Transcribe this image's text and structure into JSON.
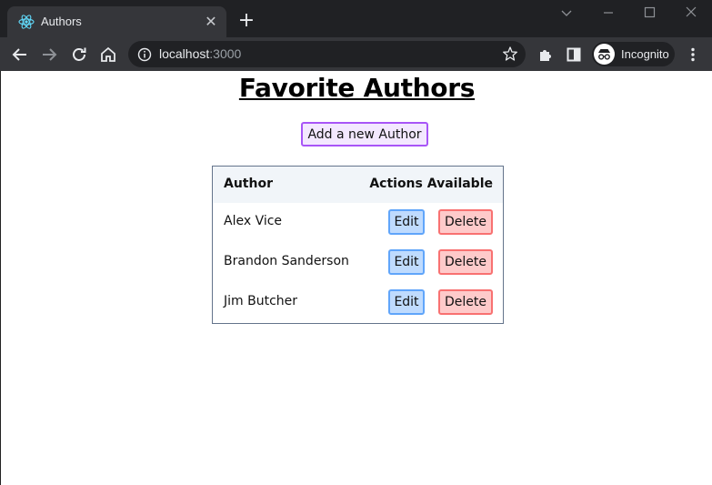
{
  "browser": {
    "tab_title": "Authors",
    "tab_close_glyph": "✕",
    "new_tab_glyph": "+",
    "url_host": "localhost",
    "url_port": ":3000",
    "profile_label": "Incognito",
    "icons": [
      "react-favicon-icon",
      "back-arrow-icon",
      "forward-arrow-icon",
      "reload-icon",
      "home-icon",
      "info-icon",
      "star-icon",
      "extensions-puzzle-icon",
      "side-panel-icon",
      "incognito-icon",
      "kebab-menu-icon",
      "tab-search-chevron-icon",
      "minimize-icon",
      "maximize-icon",
      "window-close-icon"
    ],
    "colors": {
      "titlebar_bg": "#202124",
      "toolbar_bg": "#35363a",
      "text": "#e8eaed",
      "react_blue": "#61dafb"
    }
  },
  "page": {
    "title": "Favorite Authors",
    "add_button_label": "Add a new Author",
    "table": {
      "headers": [
        "Author",
        "Actions Available"
      ],
      "rows": [
        {
          "name": "Alex Vice",
          "edit_label": "Edit",
          "delete_label": "Delete"
        },
        {
          "name": "Brandon Sanderson",
          "edit_label": "Edit",
          "delete_label": "Delete"
        },
        {
          "name": "Jim Butcher",
          "edit_label": "Edit",
          "delete_label": "Delete"
        }
      ]
    },
    "colors": {
      "add_bg": "#f3e8ff",
      "add_border": "#a855f7",
      "edit_bg": "#bfdbfe",
      "edit_border": "#60a5fa",
      "delete_bg": "#fecaca",
      "delete_border": "#f87171",
      "header_bg": "#f1f5f9",
      "table_border": "#64748b"
    }
  }
}
